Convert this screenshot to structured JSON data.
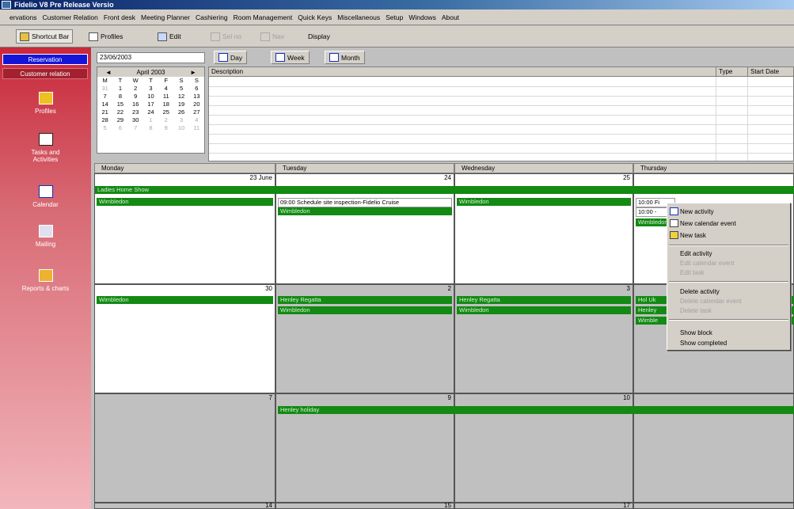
{
  "window": {
    "title": "Fidelio V8 Pre Release Versio"
  },
  "menu": [
    "ervations",
    "Customer Relation",
    "Front desk",
    "Meeting Planner",
    "Cashiering",
    "Room Management",
    "Quick Keys",
    "Miscellaneous",
    "Setup",
    "Windows",
    "About"
  ],
  "toolbar": {
    "shortcut": "Shortcut Bar",
    "profiles": "Profiles",
    "edit": "Edit",
    "dis1": "Sel no",
    "dis2": "Nav",
    "display": "Display"
  },
  "sidebar": {
    "tab_reservation": "Reservation",
    "tab_customer": "Customer relation",
    "items": [
      {
        "label1": "Profiles",
        "label2": ""
      },
      {
        "label1": "Tasks and",
        "label2": "Activities"
      },
      {
        "label1": "Calendar",
        "label2": ""
      },
      {
        "label1": "Mailing",
        "label2": ""
      },
      {
        "label1": "Reports & charts",
        "label2": ""
      }
    ]
  },
  "date_field": "23/06/2003",
  "views": {
    "day": "Day",
    "week": "Week",
    "month": "Month"
  },
  "minical": {
    "month": "April 2003",
    "days": [
      "M",
      "T",
      "W",
      "T",
      "F",
      "S",
      "S"
    ],
    "weeks": [
      [
        "31",
        "1",
        "2",
        "3",
        "4",
        "5",
        "6"
      ],
      [
        "7",
        "8",
        "9",
        "10",
        "11",
        "12",
        "13"
      ],
      [
        "14",
        "15",
        "16",
        "17",
        "18",
        "19",
        "20"
      ],
      [
        "21",
        "22",
        "23",
        "24",
        "25",
        "26",
        "27"
      ],
      [
        "28",
        "29",
        "30",
        "1",
        "2",
        "3",
        "4"
      ],
      [
        "5",
        "6",
        "7",
        "8",
        "9",
        "10",
        "11"
      ]
    ]
  },
  "tasklist": {
    "col_description": "Description",
    "col_type": "Type",
    "col_start": "Start Date"
  },
  "calendar": {
    "days": [
      "Monday",
      "Tuesday",
      "Wednesday",
      "Thursday"
    ],
    "week1": {
      "d1": "23 June",
      "d2": "24",
      "d3": "25"
    },
    "week2": {
      "d1": "30",
      "d2": "2",
      "d3": "3"
    },
    "week3": {
      "d1": "7",
      "d2": "9",
      "d3": "10"
    },
    "week4": {
      "d1": "14",
      "d2": "15",
      "d3": "17"
    },
    "span_event": "Ladies Home Show",
    "wimbledon": "Wimbledon",
    "event_tue": "09:00 Schedule site inspection-Fidelio Cruise",
    "thu_event1": "10:00 Fi",
    "thu_event2": "10:00 -",
    "henley": "Henley Regatta",
    "thu_w2_a": "Hol Uk",
    "thu_w2_b": "Henley",
    "thu_w2_c": "Wimble",
    "holiday": "Henley holiday"
  },
  "context_menu": {
    "new_activity": "New activity",
    "new_calendar_event": "New calendar event",
    "new_task": "New task",
    "edit_activity": "Edit activity",
    "edit_event_dis": "Edit calendar event",
    "edit_task_dis": "Edit task",
    "delete_activity": "Delete activity",
    "delete_event_dis": "Delete calendar event",
    "delete_task_dis": "Delete task",
    "show_block": "Show block",
    "show_completed": "Show completed"
  }
}
